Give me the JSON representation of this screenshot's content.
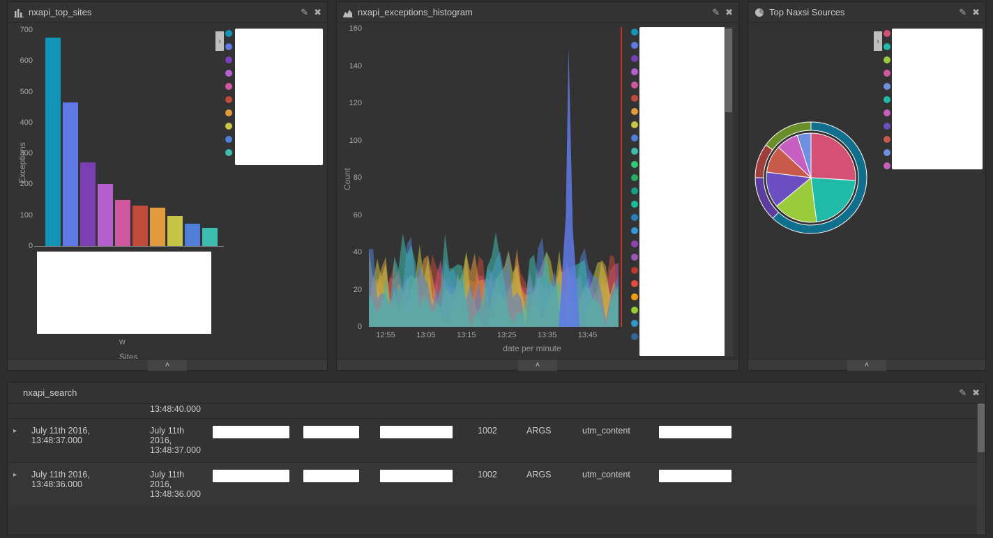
{
  "panels": {
    "top_sites": {
      "title": "nxapi_top_sites",
      "icon": "bar-chart-icon",
      "ylabel": "Exceptions",
      "xlabel": "Sites",
      "xlabel_sub": "w",
      "yticks": [
        0,
        100,
        200,
        300,
        400,
        500,
        600,
        700
      ]
    },
    "histogram": {
      "title": "nxapi_exceptions_histogram",
      "icon": "area-chart-icon",
      "ylabel": "Count",
      "xlabel": "date per minute",
      "yticks": [
        0,
        20,
        40,
        60,
        80,
        100,
        120,
        140,
        160
      ],
      "xticks": [
        "12:55",
        "13:05",
        "13:15",
        "13:25",
        "13:35",
        "13:45"
      ]
    },
    "sources": {
      "title": "Top Naxsi Sources",
      "icon": "pie-chart-icon"
    },
    "search": {
      "title": "nxapi_search"
    }
  },
  "chart_data": [
    {
      "id": "top_sites",
      "type": "bar",
      "ylabel": "Exceptions",
      "xlabel": "Sites",
      "ylim": [
        0,
        700
      ],
      "values": [
        675,
        465,
        270,
        200,
        148,
        130,
        125,
        98,
        72,
        58
      ],
      "colors": [
        "#1395ba",
        "#5f7ae6",
        "#7b3fb5",
        "#b65fce",
        "#d056a0",
        "#c14b3a",
        "#e29a3d",
        "#c7c447",
        "#4f7fd6",
        "#3fbcb0"
      ]
    },
    {
      "id": "histogram",
      "type": "area",
      "ylabel": "Count",
      "xlabel": "date per minute",
      "x": [
        "12:50",
        "12:55",
        "13:00",
        "13:05",
        "13:10",
        "13:15",
        "13:20",
        "13:25",
        "13:30",
        "13:35",
        "13:40",
        "13:45",
        "13:50"
      ],
      "ylim": [
        0,
        160
      ],
      "series_count_approx": 24,
      "note": "Stacked area with many colored series; a large blue spike near 13:36 reaching ~150, baseline activity ~5-35 elsewhere.",
      "peak": {
        "x": "13:36",
        "value": 150
      },
      "legend_colors": [
        "#1395ba",
        "#5f7ae6",
        "#7b3fb5",
        "#b65fce",
        "#d056a0",
        "#c14b3a",
        "#e29a3d",
        "#c7c447",
        "#4f7fd6",
        "#3fbcb0",
        "#2ecc71",
        "#27ae60",
        "#16a085",
        "#1abc9c",
        "#2980b9",
        "#3498db",
        "#8e44ad",
        "#9b59b6",
        "#c0392b",
        "#e74c3c",
        "#f39c12",
        "#99cc33",
        "#3399cc",
        "#336699"
      ]
    },
    {
      "id": "sources",
      "type": "pie",
      "donut_outer_ring": true,
      "slices": [
        {
          "value": 26,
          "color": "#d45075"
        },
        {
          "value": 22,
          "color": "#1fbaa8"
        },
        {
          "value": 16,
          "color": "#9acb3a"
        },
        {
          "value": 13,
          "color": "#6b4fc1"
        },
        {
          "value": 10,
          "color": "#c75a4a"
        },
        {
          "value": 8,
          "color": "#c65fc0"
        },
        {
          "value": 5,
          "color": "#6f8fe0"
        }
      ],
      "outer_ring_slices": [
        {
          "value": 62,
          "color": "#0f6f8c"
        },
        {
          "value": 13,
          "color": "#5a3d9e"
        },
        {
          "value": 10,
          "color": "#9e3f3a"
        },
        {
          "value": 15,
          "color": "#6a8f2a"
        }
      ],
      "legend_colors": [
        "#d45075",
        "#1fbaa8",
        "#9acb3a",
        "#d056a0",
        "#6f8fe0",
        "#1fbaa8",
        "#c65fc0",
        "#6b4fc1",
        "#c75a4a",
        "#6f8fe0",
        "#c65fc0"
      ]
    }
  ],
  "search_rows": [
    {
      "partial_ts_tail": "13:48:40.000",
      "time": "",
      "time2_lines": [
        "",
        "",
        ""
      ]
    },
    {
      "time": "July 11th 2016, 13:48:37.000",
      "time2_lines": [
        "July 11th",
        "2016,",
        "13:48:37.000"
      ],
      "id": "1002",
      "args": "ARGS",
      "utm": "utm_content"
    },
    {
      "time": "July 11th 2016, 13:48:36.000",
      "time2_lines": [
        "July 11th",
        "2016,",
        "13:48:36.000"
      ],
      "id": "1002",
      "args": "ARGS",
      "utm": "utm_content"
    }
  ],
  "icons": {
    "edit": "✎",
    "close": "✖",
    "chevron_up": "˄",
    "chevron_right": "›",
    "expand_row": "▸"
  }
}
